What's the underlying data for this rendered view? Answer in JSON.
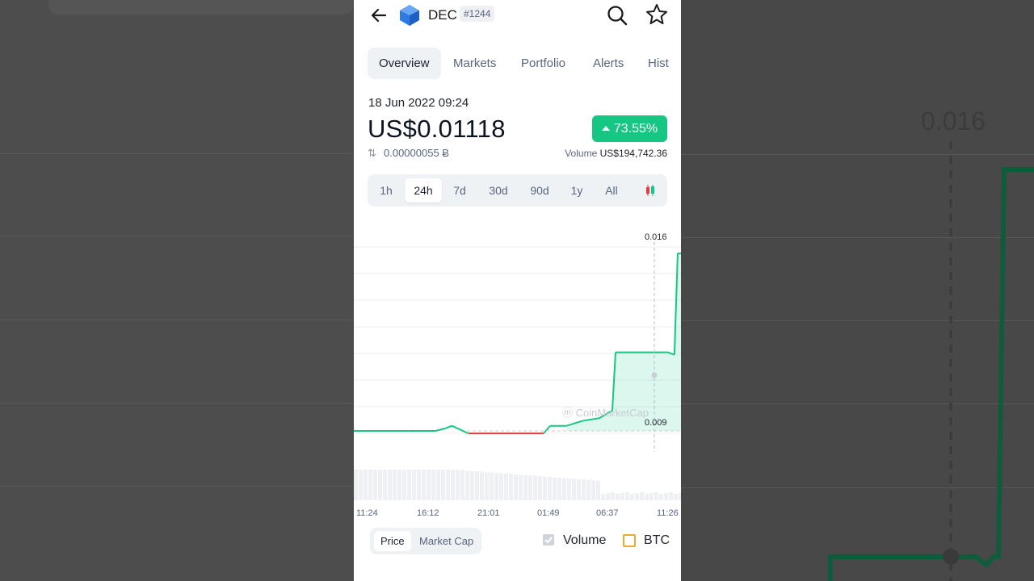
{
  "header": {
    "coin_symbol": "DEC",
    "rank": "#1244"
  },
  "tabs": [
    {
      "label": "Overview",
      "active": true
    },
    {
      "label": "Markets",
      "active": false
    },
    {
      "label": "Portfolio",
      "active": false
    },
    {
      "label": "Alerts",
      "active": false
    },
    {
      "label": "Hist",
      "active": false
    }
  ],
  "price_info": {
    "date": "18 Jun 2022 09:24",
    "price": "US$0.01118",
    "change": "73.55%",
    "btc_price": "0.00000055 Ƀ",
    "volume_label": "Volume",
    "volume_value": "US$194,742.36"
  },
  "time_ranges": [
    {
      "label": "1h",
      "active": false
    },
    {
      "label": "24h",
      "active": true
    },
    {
      "label": "7d",
      "active": false
    },
    {
      "label": "30d",
      "active": false
    },
    {
      "label": "90d",
      "active": false
    },
    {
      "label": "1y",
      "active": false
    },
    {
      "label": "All",
      "active": false
    }
  ],
  "chart_data": {
    "type": "line",
    "y_high_label": "0.016",
    "y_low_label": "0.009",
    "x_ticks": [
      "11:24",
      "16:12",
      "21:01",
      "01:49",
      "06:37",
      "11:26"
    ],
    "watermark": "CoinMarketCap",
    "x": [
      0,
      0.17,
      0.25,
      0.28,
      0.3,
      0.35,
      0.4,
      0.5,
      0.58,
      0.6,
      0.65,
      0.7,
      0.75,
      0.79,
      0.8,
      0.95,
      0.96,
      0.98,
      0.99,
      1.0
    ],
    "y": [
      0.009,
      0.009,
      0.009,
      0.0091,
      0.0092,
      0.0089,
      0.0089,
      0.0089,
      0.0089,
      0.0092,
      0.0092,
      0.0094,
      0.0095,
      0.0098,
      0.0121,
      0.0121,
      0.0121,
      0.012,
      0.016,
      0.016
    ],
    "colors": {
      "up": "#16c784",
      "down": "#ea3943"
    }
  },
  "footer": {
    "price_label": "Price",
    "market_cap_label": "Market Cap",
    "volume_label": "Volume",
    "btc_label": "BTC"
  },
  "background": {
    "right_label": "0.016"
  }
}
